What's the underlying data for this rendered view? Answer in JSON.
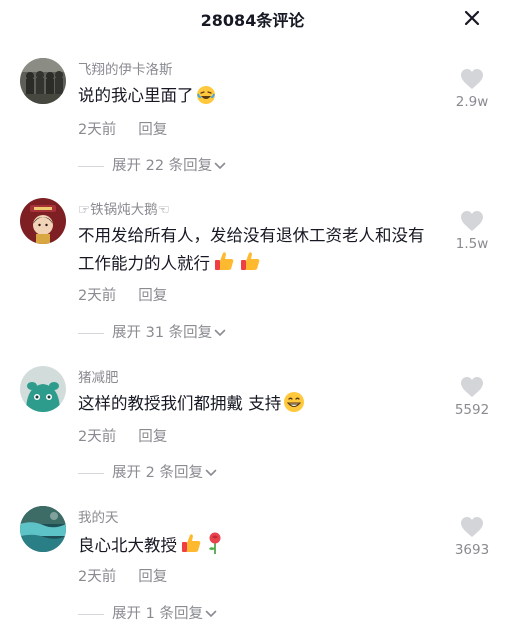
{
  "header": {
    "title": "28084条评论"
  },
  "comments": [
    {
      "username": "飞翔的伊卡洛斯",
      "text": "说的我心里面了",
      "time": "2天前",
      "reply": "回复",
      "expand": "展开 22 条回复",
      "likes": "2.9w"
    },
    {
      "username": "☞铁锅炖大鹅☜",
      "text": "不用发给所有人，发给没有退休工资老人和没有工作能力的人就行",
      "time": "2天前",
      "reply": "回复",
      "expand": "展开 31 条回复",
      "likes": "1.5w"
    },
    {
      "username": "猪减肥",
      "text": "这样的教授我们都拥戴 支持",
      "time": "2天前",
      "reply": "回复",
      "expand": "展开 2 条回复",
      "likes": "5592"
    },
    {
      "username": "我的天",
      "text": "良心北大教授",
      "time": "2天前",
      "reply": "回复",
      "expand": "展开 1 条回复",
      "likes": "3693"
    }
  ],
  "icons": {
    "close": "close-icon",
    "heart": "heart-icon",
    "chevron": "chevron-down-icon",
    "emoji_laugh": "rofl-emoji-icon",
    "emoji_thumbs": "thumbs-up-emoji-icon",
    "emoji_grin": "grinning-emoji-icon",
    "emoji_rose": "rose-emoji-icon"
  },
  "colors": {
    "text": "#161823",
    "secondary": "#8a8b91",
    "heart": "#d4d5d9"
  }
}
